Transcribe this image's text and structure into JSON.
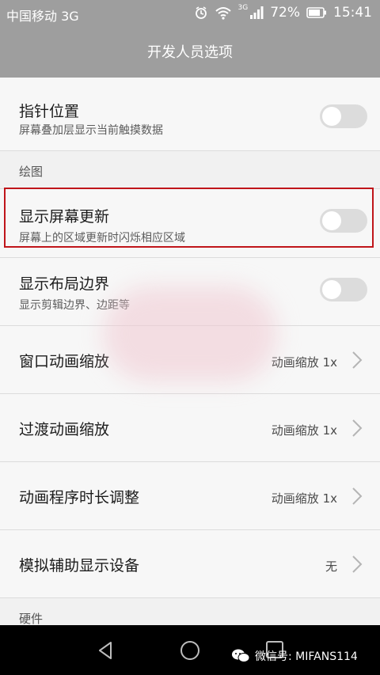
{
  "status": {
    "carrier": "中国移动 3G",
    "network_tag": "3G",
    "battery": "72%",
    "time": "15:41"
  },
  "header": {
    "title": "开发人员选项"
  },
  "items": [
    {
      "title": "指针位置",
      "subtitle": "屏幕叠加层显示当前触摸数据",
      "toggle_on": false
    },
    {
      "section": "绘图"
    },
    {
      "title": "显示屏幕更新",
      "subtitle": "屏幕上的区域更新时闪烁相应区域",
      "toggle_on": false
    },
    {
      "title": "显示布局边界",
      "subtitle": "显示剪辑边界、边距等",
      "toggle_on": false
    },
    {
      "title": "窗口动画缩放",
      "value": "动画缩放 1x"
    },
    {
      "title": "过渡动画缩放",
      "value": "动画缩放 1x"
    },
    {
      "title": "动画程序时长调整",
      "value": "动画缩放 1x"
    },
    {
      "title": "模拟辅助显示设备",
      "value": "无"
    },
    {
      "section": "硬件"
    }
  ],
  "watermark": "微信号: MIFANS114",
  "colors": {
    "bar": "#9e9e9e",
    "highlight": "#c0151a",
    "toggle_off": "#dcdcdc"
  }
}
